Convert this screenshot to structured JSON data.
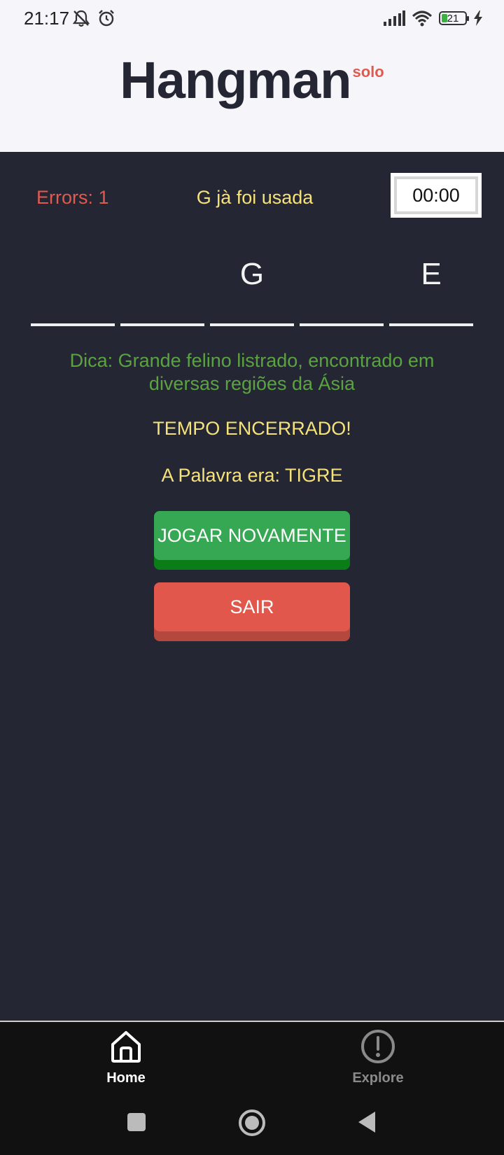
{
  "status_bar": {
    "time": "21:17",
    "battery": "21"
  },
  "header": {
    "title": "Hangman",
    "subtitle": "solo"
  },
  "game": {
    "errors_label": "Errors: 1",
    "message": "G jà foi usada",
    "timer": "00:00",
    "word_slots": [
      "",
      "",
      "G",
      "",
      "E"
    ],
    "hint": "Dica: Grande felino listrado, encontrado em diversas regiões da Ásia",
    "status": "TEMPO ENCERRADO!",
    "answer": "A Palavra era: TIGRE",
    "play_again_label": "JOGAR NOVAMENTE",
    "exit_label": "SAIR"
  },
  "bottom_nav": {
    "items": [
      {
        "label": "Home",
        "icon": "home-icon",
        "active": true
      },
      {
        "label": "Explore",
        "icon": "explore-icon",
        "active": false
      }
    ]
  },
  "colors": {
    "background": "#252633",
    "error": "#e05a4e",
    "message": "#f5e27a",
    "hint": "#5aa341",
    "play_button": "#36a853",
    "exit_button": "#e2574c"
  }
}
